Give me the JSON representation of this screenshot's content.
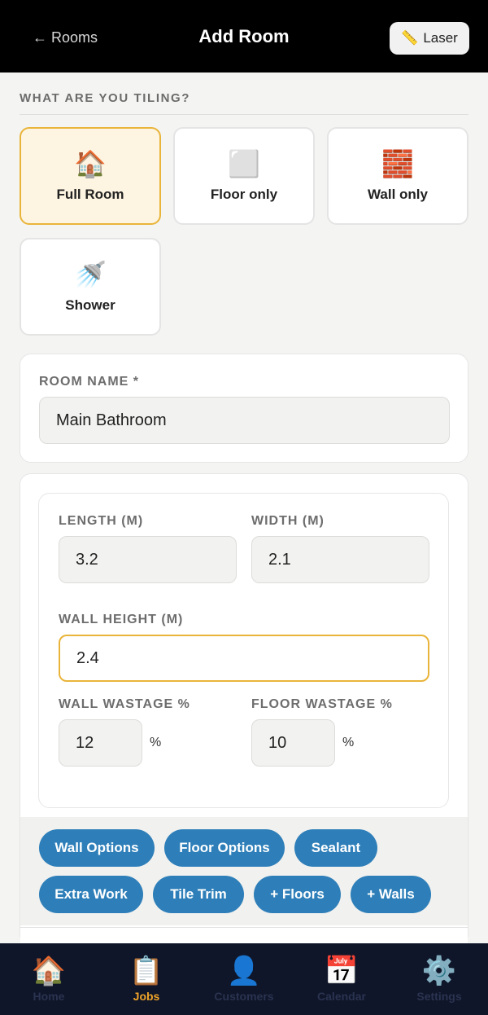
{
  "header": {
    "back_label": "← Rooms",
    "title": "Add Room",
    "laser_icon": "ruler-icon",
    "laser_glyph": "📏",
    "laser_label": "Laser"
  },
  "tiling": {
    "section_label": "WHAT ARE YOU TILING?",
    "options": [
      {
        "icon": "house-icon",
        "glyph": "🏠",
        "label": "Full Room",
        "selected": true
      },
      {
        "icon": "floor-tile-icon",
        "glyph": "⬜",
        "label": "Floor only",
        "selected": false
      },
      {
        "icon": "brick-wall-icon",
        "glyph": "🧱",
        "label": "Wall only",
        "selected": false
      },
      {
        "icon": "shower-icon",
        "glyph": "🚿",
        "label": "Shower",
        "selected": false
      }
    ]
  },
  "room": {
    "name_label": "ROOM NAME *",
    "name_value": "Main Bathroom"
  },
  "dimensions": {
    "length_label": "LENGTH (M)",
    "length_value": "3.2",
    "width_label": "WIDTH (M)",
    "width_value": "2.1",
    "wall_height_label": "WALL HEIGHT (M)",
    "wall_height_value": "2.4",
    "wall_wastage_label": "WALL WASTAGE %",
    "wall_wastage_value": "12",
    "wall_wastage_unit": "%",
    "floor_wastage_label": "FLOOR WASTAGE %",
    "floor_wastage_value": "10",
    "floor_wastage_unit": "%"
  },
  "options": {
    "wall_options": "Wall Options",
    "floor_options": "Floor Options",
    "sealant": "Sealant",
    "extra_work": "Extra Work",
    "tile_trim": "Tile Trim",
    "add_floors": "+ Floors",
    "add_walls": "+ Walls"
  },
  "nav": {
    "items": [
      {
        "icon": "home-icon",
        "glyph": "🏠",
        "label": "Home",
        "active": false
      },
      {
        "icon": "clipboard-icon",
        "glyph": "📋",
        "label": "Jobs",
        "active": true
      },
      {
        "icon": "person-icon",
        "glyph": "👤",
        "label": "Customers",
        "active": false
      },
      {
        "icon": "calendar-icon",
        "glyph": "📅",
        "label": "Calendar",
        "active": false
      },
      {
        "icon": "gear-icon",
        "glyph": "⚙️",
        "label": "Settings",
        "active": false
      }
    ]
  },
  "colors": {
    "accent": "#e9b43a",
    "pill_blue": "#2e7fb9",
    "active_nav": "#f0a429",
    "nav_bg": "#0f1629"
  }
}
